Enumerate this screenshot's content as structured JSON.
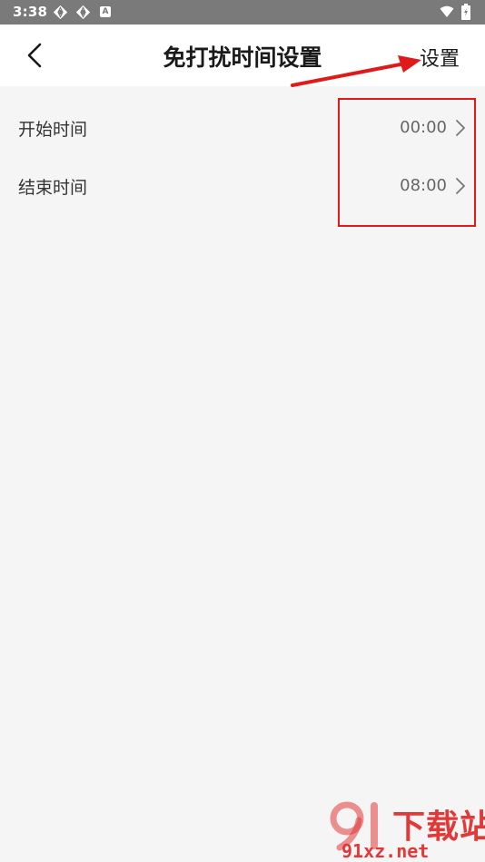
{
  "status_bar": {
    "time": "3:38",
    "icons": [
      "vpn-key-icon",
      "vpn-key-icon",
      "a-icon",
      "wifi-icon",
      "battery-icon"
    ],
    "a_glyph": "A"
  },
  "header": {
    "title": "免打扰时间设置",
    "action_label": "设置",
    "back_icon": "chevron-left-icon"
  },
  "rows": [
    {
      "label": "开始时间",
      "value": "00:00",
      "icon": "chevron-right-icon"
    },
    {
      "label": "结束时间",
      "value": "08:00",
      "icon": "chevron-right-icon"
    }
  ],
  "watermark": {
    "text_cn": "下载站",
    "text_en": "91xz.net"
  },
  "colors": {
    "status_bar_bg": "#7a7a7a",
    "background": "#f5f5f5",
    "header_bg": "#ffffff",
    "annotation": "#e01a1a",
    "watermark": "#e23838"
  }
}
